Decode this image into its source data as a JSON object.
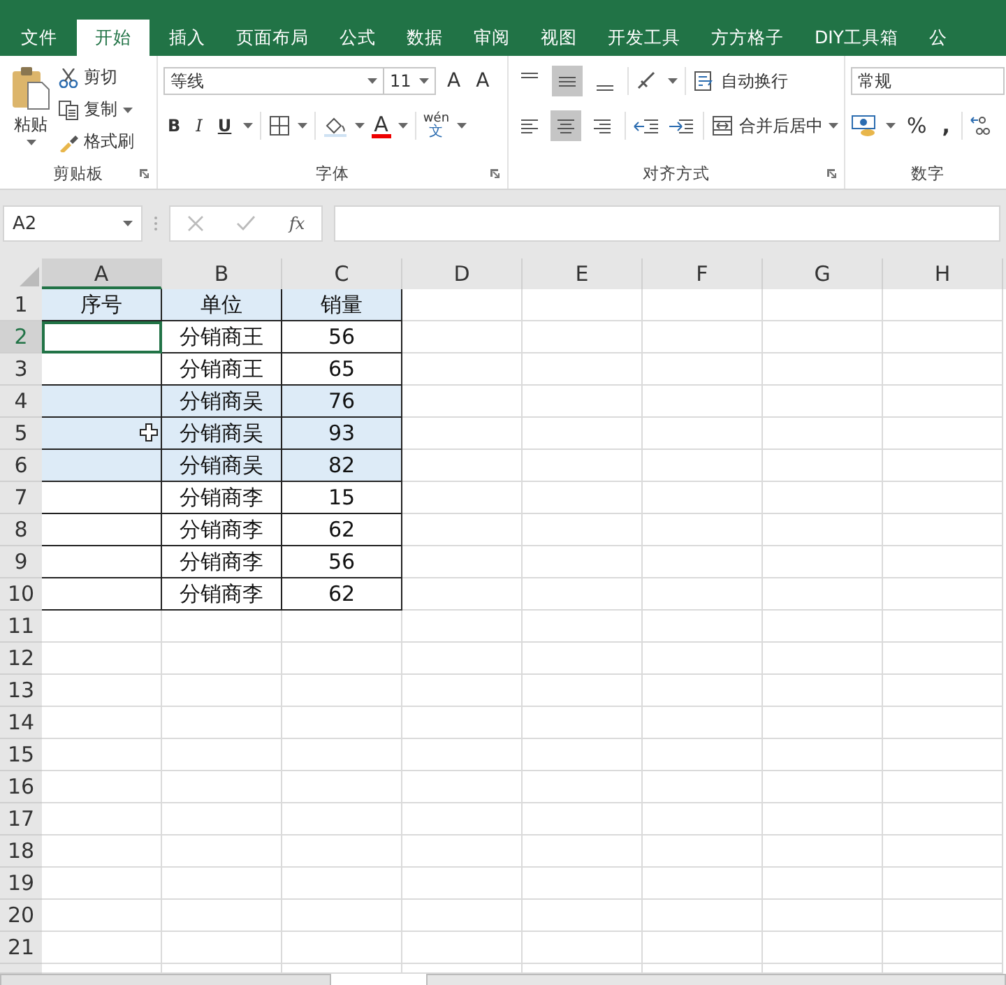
{
  "ribbon_tabs": [
    {
      "label": "文件",
      "selected": false
    },
    {
      "label": "开始",
      "selected": true
    },
    {
      "label": "插入",
      "selected": false
    },
    {
      "label": "页面布局",
      "selected": false
    },
    {
      "label": "公式",
      "selected": false
    },
    {
      "label": "数据",
      "selected": false
    },
    {
      "label": "审阅",
      "selected": false
    },
    {
      "label": "视图",
      "selected": false
    },
    {
      "label": "开发工具",
      "selected": false
    },
    {
      "label": "方方格子",
      "selected": false
    },
    {
      "label": "DIY工具箱",
      "selected": false
    },
    {
      "label": "公",
      "selected": false
    }
  ],
  "clipboard": {
    "title": "剪贴板",
    "paste": "粘贴",
    "cut": "剪切",
    "copy": "复制",
    "format_painter": "格式刷"
  },
  "font": {
    "title": "字体",
    "font_name": "等线",
    "font_size": "11",
    "grow": "A",
    "shrink": "A",
    "bold": "B",
    "italic": "I",
    "underline": "U",
    "font_color": "A",
    "phonetic_top": "wén",
    "phonetic_bottom": "文"
  },
  "alignment": {
    "title": "对齐方式",
    "vertical": [
      {
        "kind": "top",
        "selected": false
      },
      {
        "kind": "middle",
        "selected": true
      },
      {
        "kind": "bottom",
        "selected": false
      }
    ],
    "horizontal": [
      {
        "kind": "left",
        "selected": false
      },
      {
        "kind": "center",
        "selected": true
      },
      {
        "kind": "right",
        "selected": false
      }
    ],
    "wrap_text": "自动换行",
    "merge_center": "合并后居中"
  },
  "number": {
    "title": "数字",
    "format": "常规",
    "percent": "%",
    "comma": ","
  },
  "formula_bar": {
    "name_box": "A2",
    "fx": "fx"
  },
  "sheet": {
    "columns": [
      {
        "label": "A",
        "selected": true
      },
      {
        "label": "B",
        "selected": false
      },
      {
        "label": "C",
        "selected": false
      },
      {
        "label": "D",
        "selected": false
      },
      {
        "label": "E",
        "selected": false
      },
      {
        "label": "F",
        "selected": false
      },
      {
        "label": "G",
        "selected": false
      },
      {
        "label": "H",
        "selected": false
      }
    ],
    "rows": [
      {
        "number": "1",
        "selected": false,
        "highlighted": true,
        "cells": [
          "序号",
          "单位",
          "销量"
        ]
      },
      {
        "number": "2",
        "selected": true,
        "highlighted": false,
        "cells": [
          "",
          "分销商王",
          "56"
        ]
      },
      {
        "number": "3",
        "selected": false,
        "highlighted": false,
        "cells": [
          "",
          "分销商王",
          "65"
        ]
      },
      {
        "number": "4",
        "selected": false,
        "highlighted": true,
        "cells": [
          "",
          "分销商吴",
          "76"
        ]
      },
      {
        "number": "5",
        "selected": false,
        "highlighted": true,
        "cells": [
          "",
          "分销商吴",
          "93"
        ]
      },
      {
        "number": "6",
        "selected": false,
        "highlighted": true,
        "cells": [
          "",
          "分销商吴",
          "82"
        ]
      },
      {
        "number": "7",
        "selected": false,
        "highlighted": false,
        "cells": [
          "",
          "分销商李",
          "15"
        ]
      },
      {
        "number": "8",
        "selected": false,
        "highlighted": false,
        "cells": [
          "",
          "分销商李",
          "62"
        ]
      },
      {
        "number": "9",
        "selected": false,
        "highlighted": false,
        "cells": [
          "",
          "分销商李",
          "56"
        ]
      },
      {
        "number": "10",
        "selected": false,
        "highlighted": false,
        "cells": [
          "",
          "分销商李",
          "62"
        ]
      },
      {
        "number": "11",
        "selected": false
      },
      {
        "number": "12",
        "selected": false
      },
      {
        "number": "13",
        "selected": false
      },
      {
        "number": "14",
        "selected": false
      },
      {
        "number": "15",
        "selected": false
      },
      {
        "number": "16",
        "selected": false
      },
      {
        "number": "17",
        "selected": false
      },
      {
        "number": "18",
        "selected": false
      },
      {
        "number": "19",
        "selected": false
      },
      {
        "number": "20",
        "selected": false
      },
      {
        "number": "21",
        "selected": false
      }
    ]
  }
}
